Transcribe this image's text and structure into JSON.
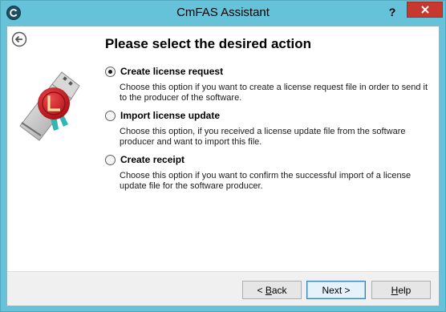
{
  "window": {
    "title": "CmFAS Assistant",
    "help_glyph": "?",
    "icons": {
      "app": "app-logo-icon",
      "close": "close-icon",
      "back": "back-arrow-icon",
      "hero": "usb-license-key-image"
    }
  },
  "page": {
    "heading": "Please select the desired action"
  },
  "options": [
    {
      "label": "Create license request",
      "description": "Choose this option if you want to create a license request file in order to send it to the producer of the software.",
      "selected": true
    },
    {
      "label": "Import license update",
      "description": "Choose this option, if you received a license update file from the software producer and want to import this file.",
      "selected": false
    },
    {
      "label": "Create receipt",
      "description": "Choose this option if you want to confirm the successful import of a license update file for the software producer.",
      "selected": false
    }
  ],
  "buttons": {
    "back_prefix": "< ",
    "back_key": "B",
    "back_rest": "ack",
    "next": "Next >",
    "help_key": "H",
    "help_rest": "elp"
  },
  "colors": {
    "titlebar": "#66c2d8",
    "close": "#c7382f",
    "seal": "#c2141b"
  }
}
